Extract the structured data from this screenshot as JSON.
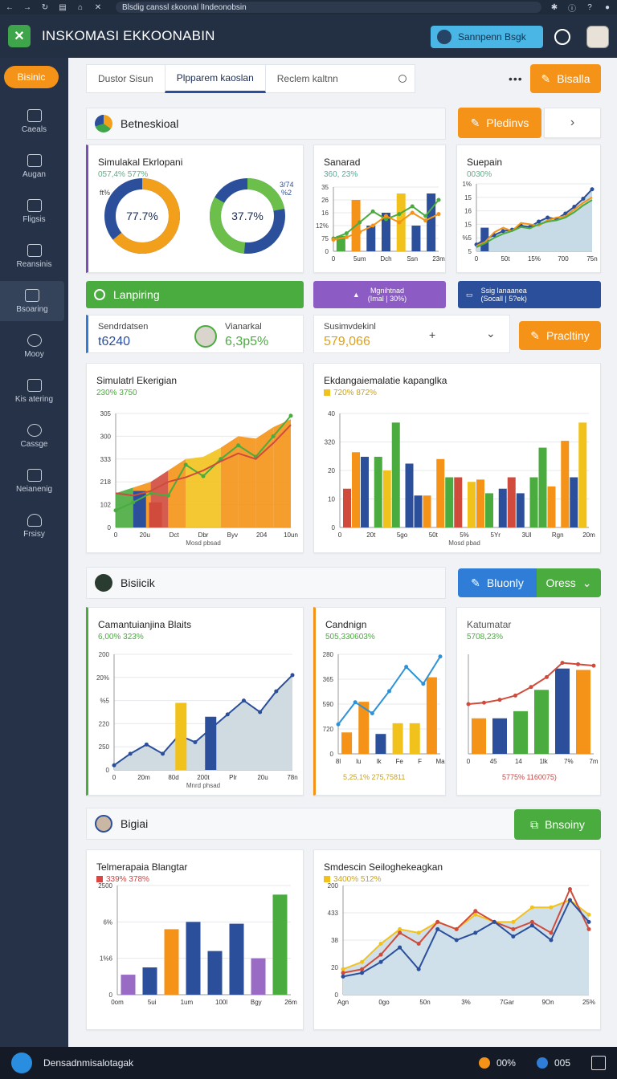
{
  "browser": {
    "url": "Blsdig canssl ɛkoonal lIndeonobsin"
  },
  "app": {
    "title": "INSKOMASI EKKOONABIN",
    "search_label": "Sannpenn Bsgk"
  },
  "sidebar": {
    "cta": "Bisinic",
    "items": [
      {
        "label": "Caeals",
        "icon": "people-icon"
      },
      {
        "label": "Augan",
        "icon": "hand-icon"
      },
      {
        "label": "Fligsis",
        "icon": "copy-icon"
      },
      {
        "label": "Reansinis",
        "icon": "mail-icon"
      },
      {
        "label": "Bsoaring",
        "icon": "edit-icon"
      },
      {
        "label": "Mooy",
        "icon": "clock-icon"
      },
      {
        "label": "Kis atering",
        "icon": "chart-icon"
      },
      {
        "label": "Cassge",
        "icon": "leaf-icon"
      },
      {
        "label": "Neianenig",
        "icon": "grid-icon"
      },
      {
        "label": "Frsisy",
        "icon": "user-icon"
      }
    ]
  },
  "toolbar": {
    "tabs": [
      "Dustor Sisun",
      "Plpparem kaoslan",
      "Reclem kaltnn"
    ],
    "active_tab": 1,
    "action": "Bisalla"
  },
  "section1": {
    "title": "Betneskioal",
    "action": "Pledinvs",
    "chevron": "›"
  },
  "donut_card": {
    "title": "Simulakal Ekrlopani",
    "subtitle": "057,4% 577%",
    "side_label": "ft%",
    "donut1": {
      "label": "77.7%",
      "values": [
        64,
        36
      ],
      "colors": [
        "#f2a01c",
        "#2b4f9a"
      ]
    },
    "donut2": {
      "label": "37.7%",
      "values": [
        22,
        78
      ],
      "colors": [
        "#6cbf4a",
        "#2b4f9a"
      ],
      "corner": "3/74\n%2"
    }
  },
  "mini1": {
    "title": "Sanarad",
    "subtitle": "360, 23%",
    "yticks": [
      "35",
      "26",
      "16",
      "12%",
      "75",
      "0"
    ],
    "xticks": [
      "0",
      "5um",
      "Dch",
      "Ssn",
      "23m"
    ]
  },
  "mini2": {
    "title": "Suepain",
    "subtitle": "0030%",
    "yticks": [
      "1%",
      "15",
      "16",
      "15",
      "%5",
      "5"
    ],
    "xticks": [
      "0",
      "50t",
      "15%",
      "700",
      "75n"
    ]
  },
  "tiles": {
    "green": "Lanpiring",
    "purple": "Mgnihtnad\n(Imal | 30%)",
    "navy": "Ssig lanaanea\n(Socall | 5?ek)"
  },
  "stats": [
    {
      "label": "Sendrdatsen",
      "value": "t6240"
    },
    {
      "label": "Vianarkal",
      "value": "6,3p5%"
    },
    {
      "label": "Susimvdekinl",
      "value": "579,066"
    }
  ],
  "stat_btn": "Pracltiny",
  "big1": {
    "title": "Simulatrl Ekerigian",
    "subtitle": "230% 3750",
    "yticks": [
      "305",
      "300",
      "333",
      "218",
      "102",
      "0"
    ],
    "xticks": [
      "0",
      "20u",
      "Dct",
      "Dbr",
      "Byv",
      "204",
      "10un"
    ],
    "xlabel": "Mosd pbsad"
  },
  "big2": {
    "title": "Ekdangaiemalatie kapanglka",
    "subtitle": "720% 872%",
    "yticks": [
      "40",
      "320",
      "20",
      "10",
      "0"
    ],
    "xticks": [
      "0",
      "20t",
      "5go",
      "50t",
      "5%",
      "5Yr",
      "3Ul",
      "Rgn",
      "20m"
    ],
    "xlabel": "Mosd pbad"
  },
  "section2": {
    "title": "Bisiicik",
    "action": "Bluonly",
    "dropdown": "Oress"
  },
  "row3": [
    {
      "title": "Camantuianjina Blaits",
      "subtitle": "6,00% 323%",
      "yticks": [
        "200",
        "20%",
        "%5",
        "220",
        "250",
        "0"
      ],
      "xticks": [
        "0",
        "20m",
        "80d",
        "200t",
        "Plr",
        "20u",
        "78n"
      ],
      "xlabel": "Mnrd phsad"
    },
    {
      "title": "Candnign",
      "subtitle": "505,330603%",
      "yticks": [
        "280",
        "365",
        "590",
        "720",
        "0"
      ],
      "xticks": [
        "8l",
        "lu",
        "lk",
        "Fe",
        "F",
        "Ma"
      ],
      "footer": "5,25,1% 275,75811"
    },
    {
      "title": "Katumatar",
      "subtitle": "5708,23%",
      "xticks": [
        "0",
        "45",
        "14",
        "1lk",
        "7%",
        "7m"
      ],
      "footer": "5775% 1160075)"
    }
  ],
  "section3": {
    "title": "Bigiai",
    "action": "Bnsoiny"
  },
  "row4": [
    {
      "title": "Telmerapaia Blangtar",
      "subtitle": "339% 378%",
      "yticks": [
        "2500",
        "6%",
        "1%6",
        "0"
      ],
      "xticks": [
        "0om",
        "5ui",
        "1um",
        "100l",
        "Bgy",
        "26m"
      ]
    },
    {
      "title": "Smdescin Seiloghekeagkan",
      "subtitle": "3400% 512%",
      "yticks": [
        "200",
        "433",
        "38",
        "20",
        "0"
      ],
      "xticks": [
        "Agn",
        "0go",
        "50n",
        "3%",
        "7Gar",
        "9On",
        "25%"
      ]
    }
  ],
  "bottombar": {
    "left": "Densadnmisalotagak",
    "pct": "00%",
    "right": "005"
  },
  "chart_data": [
    {
      "type": "pie",
      "title": "Simulakal Ekrlopani",
      "series": [
        {
          "values": [
            64,
            36
          ]
        },
        {
          "values": [
            22,
            78
          ]
        }
      ]
    },
    {
      "type": "bar",
      "title": "Sanarad",
      "categories": [
        "0",
        "5um",
        "Dch",
        "Ssn",
        "23m"
      ],
      "series": [
        {
          "values": [
            6,
            18,
            9,
            14,
            22,
            8,
            24
          ]
        },
        {
          "values": [
            5,
            24,
            10,
            17,
            9,
            13,
            11
          ]
        }
      ],
      "line": [
        8,
        11,
        20,
        26,
        19,
        23,
        30,
        21,
        28
      ]
    },
    {
      "type": "area",
      "title": "Suepain",
      "values": [
        4,
        8,
        10,
        12,
        12,
        14,
        13,
        16,
        18,
        17,
        20,
        23,
        26,
        29
      ]
    },
    {
      "type": "area",
      "title": "Simulatrl Ekerigian",
      "values": [
        102,
        120,
        118,
        165,
        160,
        200,
        214,
        262,
        250,
        270,
        305
      ]
    },
    {
      "type": "bar",
      "title": "Ekdangaiemalatie kapanglka",
      "groups": 8
    },
    {
      "type": "area",
      "title": "Camantuianjina Blaits",
      "values": [
        0,
        20,
        15,
        60,
        30,
        70,
        110,
        140,
        90,
        120,
        170
      ]
    },
    {
      "type": "bar",
      "title": "Candnign",
      "values": [
        35,
        65,
        30,
        40,
        50,
        120
      ]
    },
    {
      "type": "bar",
      "title": "Katumatar",
      "values": [
        50,
        60,
        60,
        90,
        120,
        120
      ]
    },
    {
      "type": "bar",
      "title": "Telmerapaia Blangtar",
      "values": [
        30,
        40,
        100,
        115,
        65,
        110,
        70,
        160
      ]
    },
    {
      "type": "line",
      "title": "Smdescin Seiloghekeagkan",
      "series": [
        {
          "values": [
            10,
            14,
            22,
            20,
            18,
            35,
            25,
            38,
            30,
            28,
            36,
            26,
            50,
            30
          ]
        },
        {
          "values": [
            8,
            12,
            16,
            18,
            24,
            20,
            26,
            22,
            24,
            30,
            28,
            40,
            34,
            30
          ]
        },
        {
          "values": [
            6,
            10,
            14,
            12,
            8,
            28,
            24,
            20,
            28,
            24,
            30,
            24,
            42,
            20
          ]
        }
      ]
    }
  ]
}
